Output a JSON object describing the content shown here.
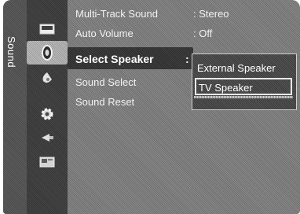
{
  "side_tab": {
    "label": "Sound"
  },
  "icons": [
    {
      "name": "picture-icon"
    },
    {
      "name": "sound-icon"
    },
    {
      "name": "channel-icon"
    },
    {
      "name": "setup-icon"
    },
    {
      "name": "input-icon"
    },
    {
      "name": "application-icon"
    }
  ],
  "menu": {
    "items": [
      {
        "label": "Multi-Track Sound",
        "value": ": Stereo"
      },
      {
        "label": "Auto Volume",
        "value": ": Off"
      },
      {
        "label": "Select Speaker",
        "value": ":"
      },
      {
        "label": "Sound Select",
        "value": ""
      },
      {
        "label": "Sound Reset",
        "value": ""
      }
    ]
  },
  "popup": {
    "options": [
      "External Speaker",
      "TV Speaker"
    ],
    "selected": "TV Speaker"
  }
}
